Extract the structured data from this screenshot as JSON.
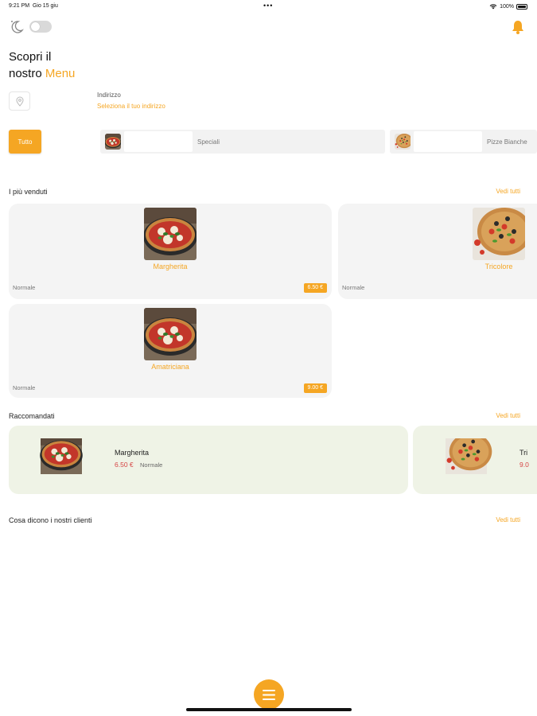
{
  "status_bar": {
    "time": "9:21 PM",
    "date": "Gio 15 giu",
    "dots": "•••",
    "battery": "100%"
  },
  "header": {
    "title_line1": "Scopri il",
    "title_line2_prefix": "nostro",
    "title_accent": "Menu"
  },
  "address": {
    "label": "Indirizzo",
    "link": "Seleziona il tuo indirizzo"
  },
  "categories": {
    "all_label": "Tutto",
    "items": [
      {
        "label": "Speciali"
      },
      {
        "label": "Pizze Bianche"
      }
    ]
  },
  "best_sellers": {
    "title": "I più venduti",
    "see_all": "Vedi tutti",
    "items": [
      {
        "name": "Margherita",
        "type": "Normale",
        "price": "6.50 €"
      },
      {
        "name": "Tricolore",
        "type": "Normale",
        "price": ""
      },
      {
        "name": "Amatriciana",
        "type": "Normale",
        "price": "9.00 €"
      }
    ]
  },
  "recommended": {
    "title": "Raccomandati",
    "see_all": "Vedi tutti",
    "items": [
      {
        "name": "Margherita",
        "price": "6.50 €",
        "type": "Normale"
      },
      {
        "name": "Tri",
        "price": "9.0"
      }
    ]
  },
  "reviews": {
    "title": "Cosa dicono i nostri clienti",
    "see_all": "Vedi tutti"
  },
  "colors": {
    "accent": "#f5a623",
    "card": "#f4f4f4",
    "recommended_card": "#eff3e6",
    "price_red": "#d64545"
  },
  "icons": [
    "moon-icon",
    "bell-icon",
    "location-pin-icon",
    "menu-icon",
    "wifi-icon",
    "battery-icon"
  ]
}
